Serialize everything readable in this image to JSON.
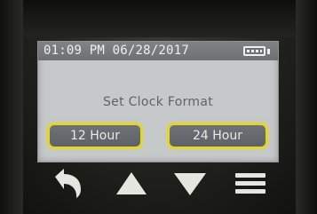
{
  "status_bar": {
    "datetime": "01:09 PM 06/28/2017",
    "battery_icon": "battery-full-icon"
  },
  "screen": {
    "prompt": "Set Clock Format",
    "options": [
      {
        "label": "12 Hour",
        "state": "highlighted"
      },
      {
        "label": "24 Hour",
        "state": "highlighted"
      }
    ]
  },
  "controls": [
    {
      "icon": "back-arrow-icon"
    },
    {
      "icon": "up-triangle-icon"
    },
    {
      "icon": "down-triangle-icon"
    },
    {
      "icon": "menu-icon"
    }
  ],
  "colors": {
    "screen_background": "#c5c9ca",
    "status_bar": "#777b7e",
    "option_highlight": "#e3d436",
    "control_icon": "#e6e6e1"
  }
}
